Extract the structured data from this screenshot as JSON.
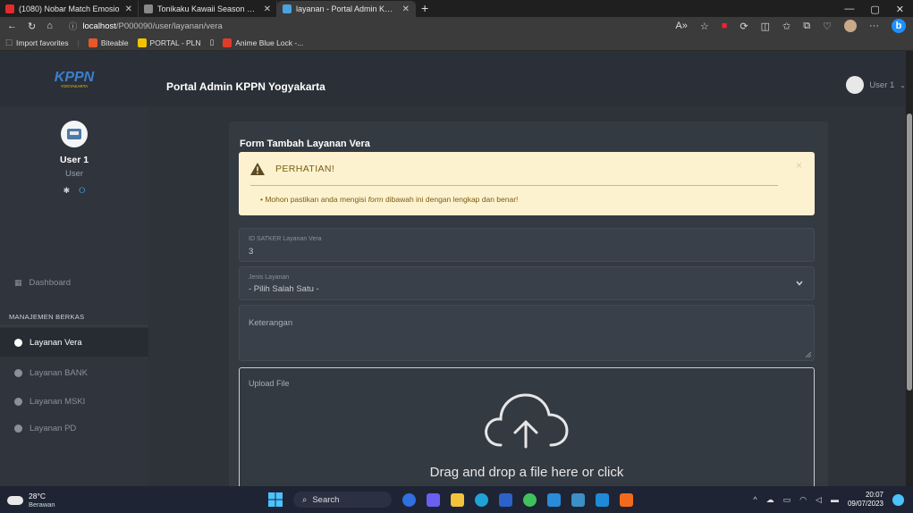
{
  "browser": {
    "tabs": [
      {
        "title": "(1080) Nobar Match Emosio",
        "favicon_color": "#e22b2b"
      },
      {
        "title": "Tonikaku Kawaii Season 2 Episod",
        "favicon_color": "#cccccc"
      },
      {
        "title": "layanan - Portal Admin KPPN Yog",
        "favicon_color": "#4aa3df"
      }
    ],
    "url_prefix": "localhost",
    "url_path": "/P000090/user/layanan/vera",
    "favorites": [
      {
        "label": "Import favorites"
      },
      {
        "label": "Biteable"
      },
      {
        "label": "PORTAL - PLN"
      },
      {
        "label": "Anime Blue Lock -..."
      }
    ]
  },
  "header": {
    "logo_text": "KPPN",
    "logo_sub": "YOGYAKARTA",
    "title": "Portal Admin KPPN Yogyakarta",
    "user_label": "User 1"
  },
  "sidebar": {
    "user_name": "User 1",
    "user_role": "User",
    "dashboard_label": "Dashboard",
    "section_header": "MANAJEMEN BERKAS",
    "items": [
      {
        "label": "Layanan Vera",
        "active": true
      },
      {
        "label": "Layanan BANK",
        "active": false
      },
      {
        "label": "Layanan MSKI",
        "active": false
      },
      {
        "label": "Layanan PD",
        "active": false
      }
    ]
  },
  "form": {
    "title": "Form Tambah Layanan Vera",
    "alert_title": "PERHATIAN!",
    "alert_msg_before": "Mohon pastikan anda mengisi ",
    "alert_msg_em": "form",
    "alert_msg_after": " dibawah ini dengan lengkap dan benar!",
    "alert_close": "×",
    "id_label": "ID SATKER Layanan Vera",
    "id_value": "3",
    "jenis_label": "Jenis Layanan",
    "jenis_value": "- Pilih Salah Satu -",
    "keterangan_placeholder": "Keterangan",
    "upload_label": "Upload File",
    "upload_hint": "Drag and drop a file here or click"
  },
  "taskbar": {
    "temperature": "28°C",
    "weather": "Berawan",
    "search_label": "Search",
    "time": "20:07",
    "date": "09/07/2023"
  }
}
